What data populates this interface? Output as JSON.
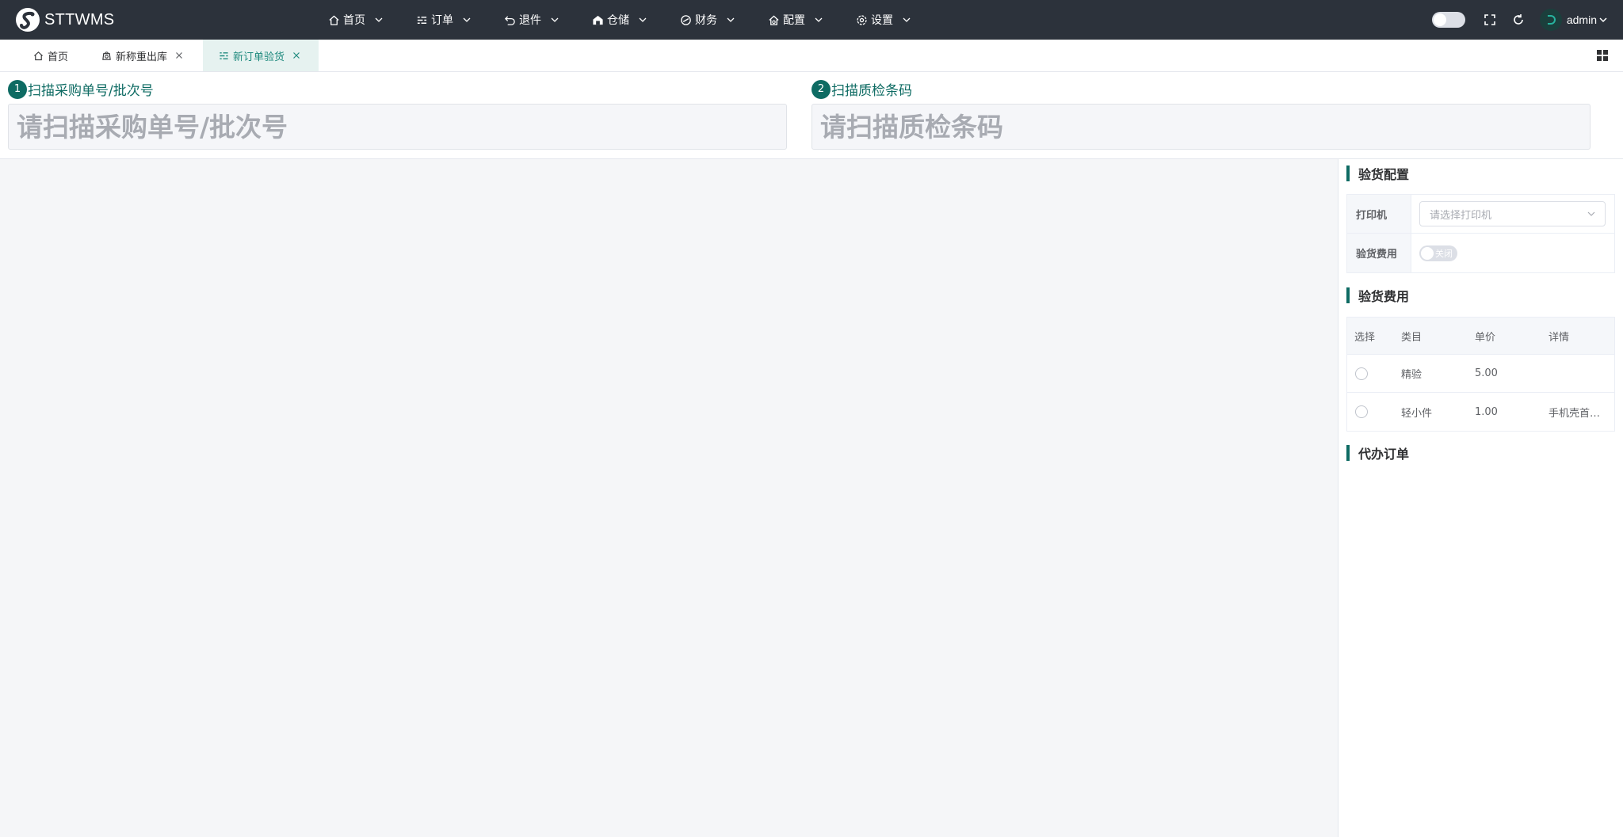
{
  "app": {
    "name": "STTWMS"
  },
  "nav": [
    {
      "label": "首页",
      "icon": "home-icon"
    },
    {
      "label": "订单",
      "icon": "order-list-icon"
    },
    {
      "label": "退件",
      "icon": "return-icon"
    },
    {
      "label": "仓储",
      "icon": "warehouse-icon"
    },
    {
      "label": "财务",
      "icon": "finance-icon"
    },
    {
      "label": "配置",
      "icon": "config-icon"
    },
    {
      "label": "设置",
      "icon": "settings-icon"
    }
  ],
  "user": {
    "name": "admin"
  },
  "tabs": [
    {
      "label": "首页",
      "icon": "home-icon",
      "closable": false,
      "active": false
    },
    {
      "label": "新称重出库",
      "icon": "scale-icon",
      "closable": true,
      "active": false
    },
    {
      "label": "新订单验货",
      "icon": "inspect-icon",
      "closable": true,
      "active": true
    }
  ],
  "scan": {
    "step1": {
      "num": "1",
      "title": "扫描采购单号/批次号",
      "placeholder": "请扫描采购单号/批次号",
      "value": ""
    },
    "step2": {
      "num": "2",
      "title": "扫描质检条码",
      "placeholder": "请扫描质检条码",
      "value": ""
    }
  },
  "config": {
    "title": "验货配置",
    "printer_label": "打印机",
    "printer_placeholder": "请选择打印机",
    "fee_label": "验货费用",
    "fee_switch_text": "关闭",
    "fee_switch_on": false
  },
  "fees": {
    "title": "验货费用",
    "headers": {
      "select": "选择",
      "category": "类目",
      "price": "单价",
      "detail": "详情"
    },
    "rows": [
      {
        "category": "精验",
        "price": "5.00",
        "detail": "",
        "selected": false
      },
      {
        "category": "轻小件",
        "price": "1.00",
        "detail": "手机壳首…",
        "selected": false
      }
    ]
  },
  "agent_orders": {
    "title": "代办订单"
  },
  "colors": {
    "topbar": "#2c323b",
    "accent": "#0e6b63",
    "active_tab_bg": "#e6f2f0"
  }
}
